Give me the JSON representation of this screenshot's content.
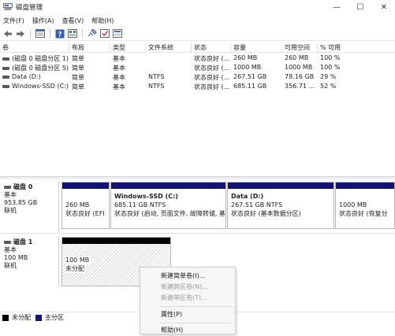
{
  "window": {
    "title": "磁盘管理",
    "controls": {
      "minimize": "—",
      "maximize": "☐",
      "close": "✕"
    }
  },
  "menubar": [
    {
      "label": "文件(F)"
    },
    {
      "label": "操作(A)"
    },
    {
      "label": "查看(V)"
    },
    {
      "label": "帮助(H)"
    }
  ],
  "toolbar": {
    "icons": [
      "back-arrow-icon",
      "forward-arrow-icon",
      "disk-list-icon",
      "help-icon",
      "properties-icon",
      "connect-icon",
      "check-icon",
      "view-icon"
    ]
  },
  "volume_table": {
    "columns": [
      "卷",
      "布局",
      "类型",
      "文件系统",
      "状态",
      "容量",
      "可用空间",
      "% 可用"
    ],
    "rows": [
      [
        "(磁盘 0 磁盘分区 1)",
        "简单",
        "基本",
        "",
        "状态良好 (...",
        "260 MB",
        "260 MB",
        "100 %"
      ],
      [
        "(磁盘 0 磁盘分区 5)",
        "简单",
        "基本",
        "",
        "状态良好 (...",
        "1000 MB",
        "1000 MB",
        "100 %"
      ],
      [
        "Data (D:)",
        "简单",
        "基本",
        "NTFS",
        "状态良好 (...",
        "267.51 GB",
        "78.16 GB",
        "29 %"
      ],
      [
        "Windows-SSD (C:)",
        "简单",
        "基本",
        "NTFS",
        "状态良好 (...",
        "685.11 GB",
        "356.71 ...",
        "52 %"
      ]
    ]
  },
  "disks": [
    {
      "name": "磁盘 0",
      "type": "基本",
      "size": "953.85 GB",
      "status": "联机",
      "partitions": [
        {
          "name": "",
          "size": "260 MB",
          "status": "状态良好 (EFI"
        },
        {
          "name": "Windows-SSD  (C:)",
          "size": "685.11 GB NTFS",
          "status": "状态良好 (启动, 页面文件, 故障转储, 基"
        },
        {
          "name": "Data  (D:)",
          "size": "267.51 GB NTFS",
          "status": "状态良好 (基本数据分区)"
        },
        {
          "name": "",
          "size": "1000 MB",
          "status": "状态良好 (恢复分"
        }
      ]
    },
    {
      "name": "磁盘 1",
      "type": "基本",
      "size": "100 MB",
      "status": "联机",
      "partitions": [
        {
          "name": "",
          "size": "100 MB",
          "status": "未分配"
        }
      ]
    }
  ],
  "legend": [
    {
      "label": "未分配",
      "color": "#000000"
    },
    {
      "label": "主分区",
      "color": "#12127a"
    }
  ],
  "context_menu": [
    {
      "label": "新建简单卷(I)...",
      "enabled": true
    },
    {
      "label": "新建跨区卷(N)...",
      "enabled": false
    },
    {
      "label": "新建带区卷(T)...",
      "enabled": false
    },
    {
      "label": "属性(P)",
      "enabled": true
    },
    {
      "label": "帮助(H)",
      "enabled": true
    }
  ]
}
